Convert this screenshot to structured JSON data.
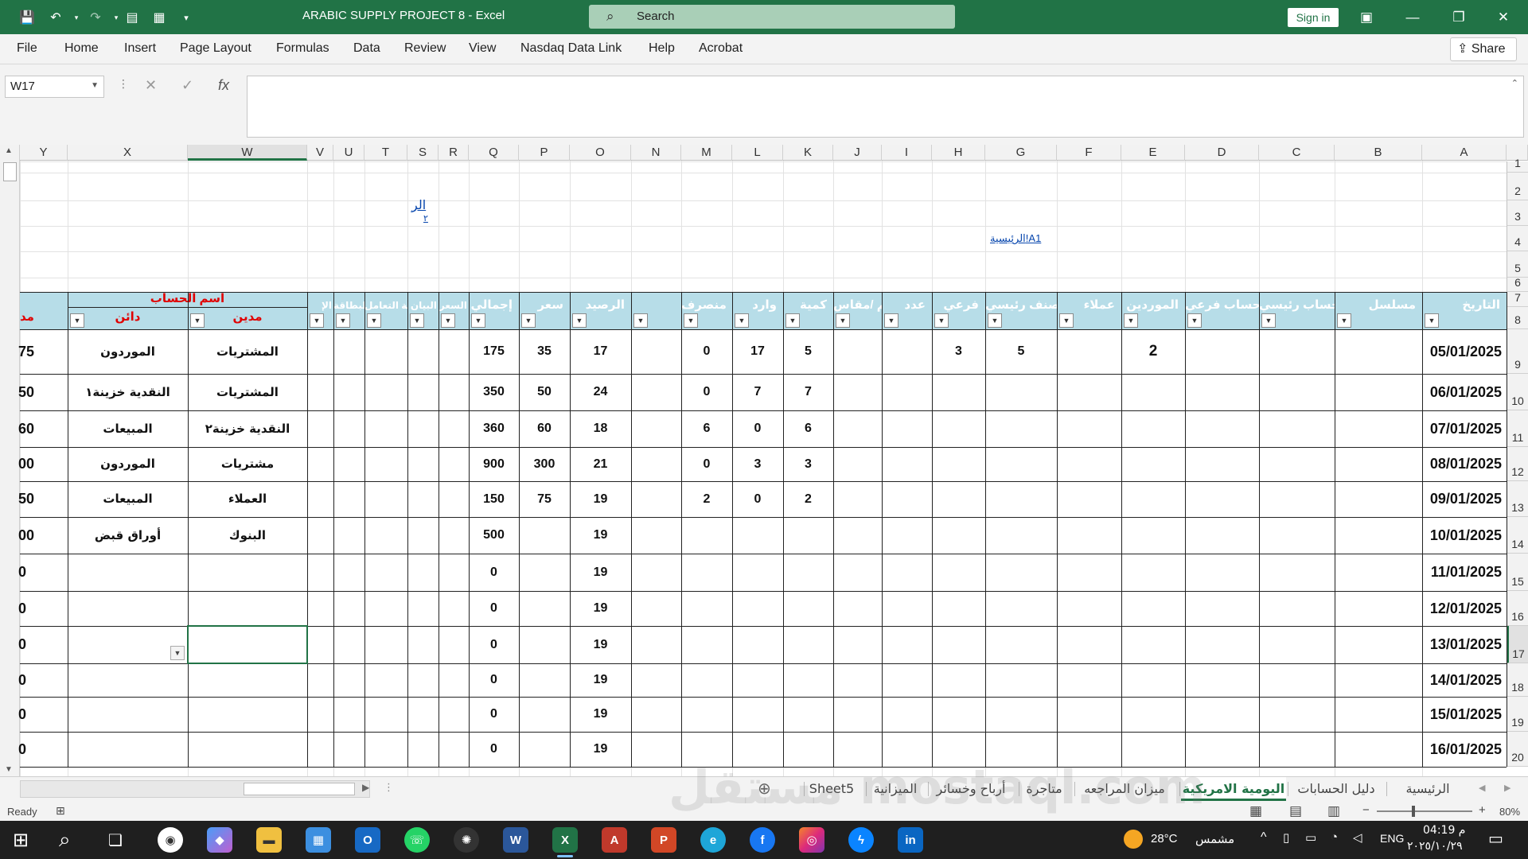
{
  "window": {
    "title": "ARABIC SUPPLY PROJECT 8  -  Excel",
    "search_placeholder": "Search",
    "sign_in": "Sign in"
  },
  "menu": [
    "File",
    "Home",
    "Insert",
    "Page Layout",
    "Formulas",
    "Data",
    "Review",
    "View",
    "Nasdaq Data Link",
    "Help",
    "Acrobat"
  ],
  "share_label": "Share",
  "formula_bar": {
    "name_box": "W17",
    "formula": "",
    "fx": "fx"
  },
  "columns": [
    "Y",
    "X",
    "W",
    "V",
    "U",
    "T",
    "S",
    "R",
    "Q",
    "P",
    "O",
    "N",
    "M",
    "L",
    "K",
    "J",
    "I",
    "H",
    "G",
    "F",
    "E",
    "D",
    "C",
    "B",
    "A"
  ],
  "selected_column": "W",
  "rows": [
    "1",
    "2",
    "3",
    "4",
    "5",
    "6",
    "7",
    "8",
    "9",
    "10",
    "11",
    "12",
    "13",
    "14",
    "15",
    "16",
    "17",
    "18",
    "19",
    "20"
  ],
  "selected_row": "17",
  "links": {
    "a1": "الرئيسية!A1",
    "s3": "الر",
    "s3b": "٢"
  },
  "table_header": {
    "account_name": "اسم الحساب",
    "debit": "مدين",
    "credit": "دائن",
    "clipped_y": "مد",
    "date": "التاريخ",
    "serial": "مسلسل",
    "main_account": "حساب رئيسي",
    "sub_account": "حساب فرعي",
    "suppliers": "الموردين",
    "customers": "عملاء",
    "main_category": "صنف رئيسي",
    "sub": "فرعي",
    "count": "عدد",
    "size": "جم /مقاس",
    "quantity": "كمية",
    "incoming": "وارد",
    "outgoing": "منصرف",
    "balance": "الرصيد",
    "price": "سعر",
    "total": "إجمالي",
    "invoice": "السعر",
    "statement": "البيان",
    "party": "جهة التعامل",
    "card_no": "رقم البطاقة",
    "notes": "الإ"
  },
  "table_rows": [
    {
      "date": "05/01/2025",
      "e": "2",
      "g": "5",
      "h": "3",
      "k": "5",
      "l": "17",
      "m": "0",
      "o": "17",
      "p": "35",
      "q": "175",
      "w": "المشتريات",
      "x": "الموردون",
      "y": "75"
    },
    {
      "date": "06/01/2025",
      "e": "",
      "g": "",
      "h": "",
      "k": "7",
      "l": "7",
      "m": "0",
      "o": "24",
      "p": "50",
      "q": "350",
      "w": "المشتريات",
      "x": "النقدية خزينة١",
      "y": "50"
    },
    {
      "date": "07/01/2025",
      "e": "",
      "g": "",
      "h": "",
      "k": "6",
      "l": "0",
      "m": "6",
      "o": "18",
      "p": "60",
      "q": "360",
      "w": "النقدية خزينة٢",
      "x": "المبيعات",
      "y": "60"
    },
    {
      "date": "08/01/2025",
      "e": "",
      "g": "",
      "h": "",
      "k": "3",
      "l": "3",
      "m": "0",
      "o": "21",
      "p": "300",
      "q": "900",
      "w": "مشتريات",
      "x": "الموردون",
      "y": "00"
    },
    {
      "date": "09/01/2025",
      "e": "",
      "g": "",
      "h": "",
      "k": "2",
      "l": "0",
      "m": "2",
      "o": "19",
      "p": "75",
      "q": "150",
      "w": "العملاء",
      "x": "المبيعات",
      "y": "50"
    },
    {
      "date": "10/01/2025",
      "e": "",
      "g": "",
      "h": "",
      "k": "",
      "l": "",
      "m": "",
      "o": "19",
      "p": "",
      "q": "500",
      "w": "البنوك",
      "x": "أوراق قبض",
      "y": "00"
    },
    {
      "date": "11/01/2025",
      "e": "",
      "g": "",
      "h": "",
      "k": "",
      "l": "",
      "m": "",
      "o": "19",
      "p": "",
      "q": "0",
      "w": "",
      "x": "",
      "y": "0"
    },
    {
      "date": "12/01/2025",
      "e": "",
      "g": "",
      "h": "",
      "k": "",
      "l": "",
      "m": "",
      "o": "19",
      "p": "",
      "q": "0",
      "w": "",
      "x": "",
      "y": "0"
    },
    {
      "date": "13/01/2025",
      "e": "",
      "g": "",
      "h": "",
      "k": "",
      "l": "",
      "m": "",
      "o": "19",
      "p": "",
      "q": "0",
      "w": "",
      "x": "",
      "y": "0"
    },
    {
      "date": "14/01/2025",
      "e": "",
      "g": "",
      "h": "",
      "k": "",
      "l": "",
      "m": "",
      "o": "19",
      "p": "",
      "q": "0",
      "w": "",
      "x": "",
      "y": "0"
    },
    {
      "date": "15/01/2025",
      "e": "",
      "g": "",
      "h": "",
      "k": "",
      "l": "",
      "m": "",
      "o": "19",
      "p": "",
      "q": "0",
      "w": "",
      "x": "",
      "y": "0"
    },
    {
      "date": "16/01/2025",
      "e": "",
      "g": "",
      "h": "",
      "k": "",
      "l": "",
      "m": "",
      "o": "19",
      "p": "",
      "q": "0",
      "w": "",
      "x": "",
      "y": "0"
    }
  ],
  "sheet_tabs": [
    "الرئيسية",
    "دليل الحسابات",
    "اليومية الامريكية",
    "ميزان المراجعه",
    "متاجرة",
    "أرباح وخسائر",
    "الميزانية",
    "Sheet5"
  ],
  "active_tab": "اليومية الامريكية",
  "status": {
    "ready": "Ready",
    "zoom": "80%"
  },
  "taskbar": {
    "weather_temp": "28°C",
    "weather_desc": "مشمس",
    "lang": "ENG",
    "time": "04:19 م",
    "date": "٢٠٢٥/١٠/٢٩"
  },
  "watermark": "مستقل mostaql.com",
  "colors": {
    "excel_green": "#217346",
    "header_fill": "#b7dde8",
    "red_text": "#e00000"
  }
}
